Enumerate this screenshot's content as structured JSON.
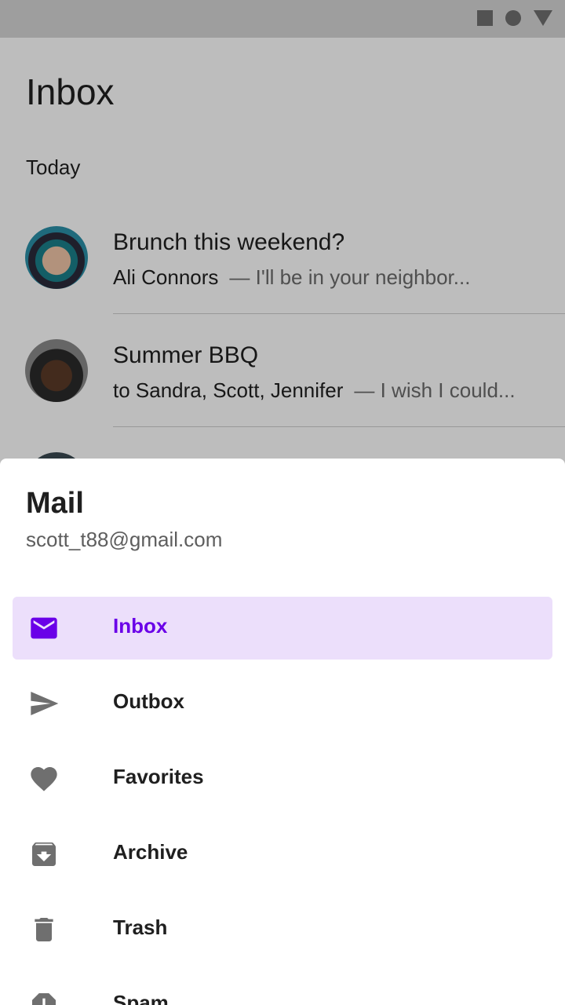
{
  "statusbar": {
    "icons": [
      "square-icon",
      "circle-icon",
      "triangle-icon"
    ]
  },
  "inbox": {
    "title": "Inbox",
    "section": "Today",
    "messages": [
      {
        "subject": "Brunch this weekend?",
        "sender": "Ali Connors",
        "preview": "— I'll be in your neighbor..."
      },
      {
        "subject": "Summer BBQ",
        "sender": "to Sandra, Scott, Jennifer",
        "preview": "— I wish I could..."
      }
    ]
  },
  "drawer": {
    "title": "Mail",
    "account": "scott_t88@gmail.com",
    "items": [
      {
        "label": "Inbox",
        "icon": "mail-icon",
        "active": true
      },
      {
        "label": "Outbox",
        "icon": "send-icon",
        "active": false
      },
      {
        "label": "Favorites",
        "icon": "heart-icon",
        "active": false
      },
      {
        "label": "Archive",
        "icon": "archive-icon",
        "active": false
      },
      {
        "label": "Trash",
        "icon": "trash-icon",
        "active": false
      },
      {
        "label": "Spam",
        "icon": "spam-icon",
        "active": false
      }
    ]
  },
  "colors": {
    "accent": "#6a00e8",
    "active_bg": "#ecdffb",
    "icon_gray": "#6f6f6f"
  }
}
